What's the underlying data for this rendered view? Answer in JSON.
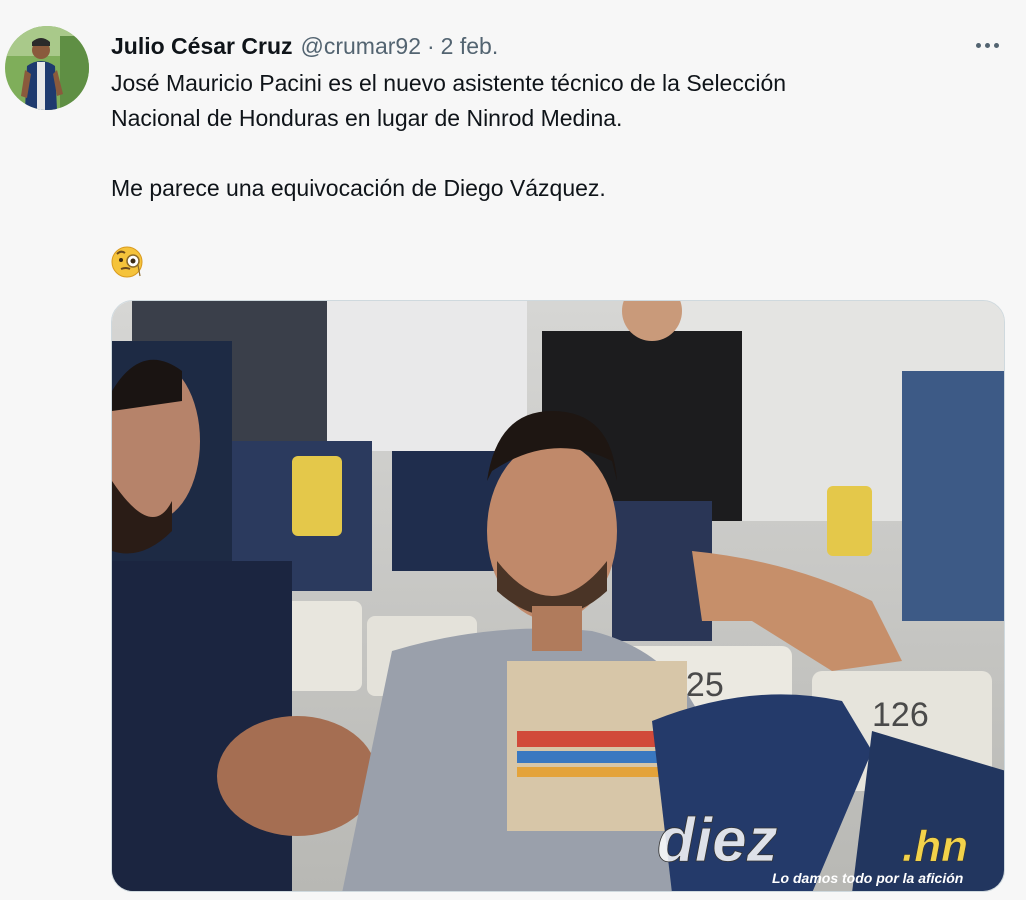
{
  "tweet": {
    "author_name": "Julio César Cruz",
    "handle": "@crumar92",
    "separator": "·",
    "date": "2 feb.",
    "text_line1": "José Mauricio Pacini es el nuevo asistente técnico de la Selección",
    "text_line2": "Nacional de Honduras en lugar de Ninrod Medina.",
    "text_line3": "Me parece una equivocación de Diego Vázquez.",
    "emoji": "face-with-monocle"
  },
  "media": {
    "seat_number_1": "125",
    "seat_number_2": "126",
    "watermark_brand": "diez",
    "watermark_tld": ".hn",
    "watermark_tagline": "Lo damos todo por la afición"
  },
  "colors": {
    "background": "#f7f7f7",
    "text": "#0f1419",
    "secondary_text": "#536471"
  }
}
